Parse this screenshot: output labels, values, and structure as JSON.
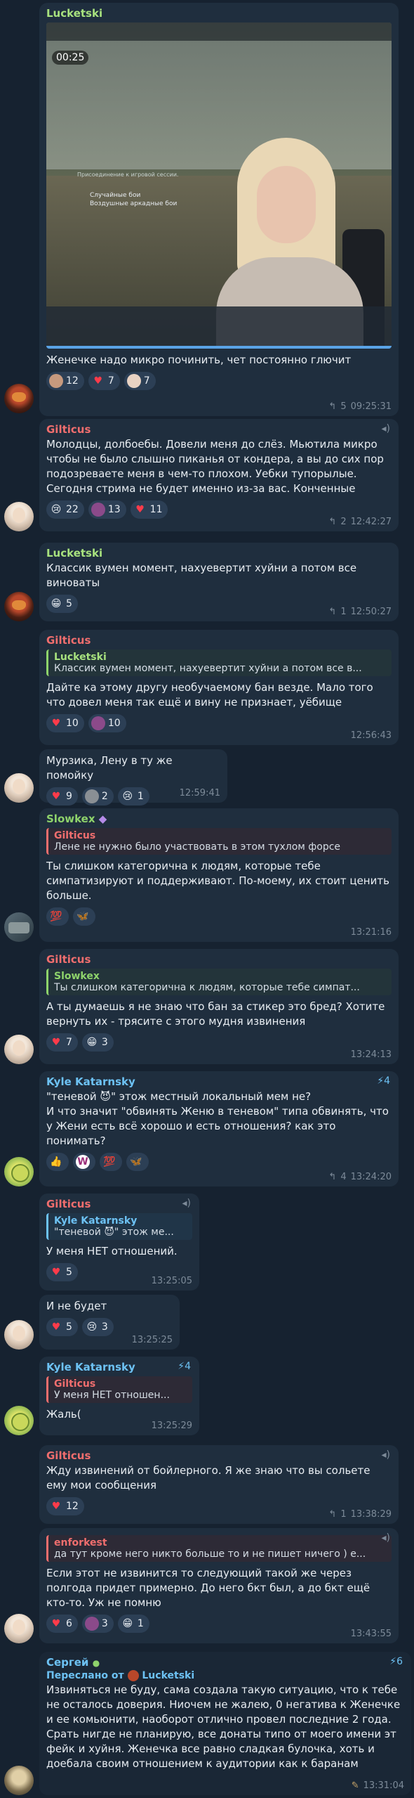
{
  "messages": {
    "m1": {
      "sender": "Lucketski",
      "video_duration": "00:25",
      "video_overlay_1": "Присоединение к игровой сессии.",
      "video_overlay_2": "Случайные бои",
      "video_overlay_3": "Воздушные аркадные бои",
      "text": "Женечке надо микро починить, чет постоянно глючит",
      "reactions": [
        {
          "icon": "face-avatar",
          "count": "12"
        },
        {
          "icon": "heart",
          "count": "7"
        },
        {
          "icon": "face-avatar",
          "count": "7"
        }
      ],
      "replies": "5",
      "time": "09:25:31"
    },
    "m2": {
      "sender": "Gilticus",
      "text": "Молодцы, долбоебы. Довели меня до слёз. Мьютила микро чтобы не было слышно пиканья от кондера, а вы до сих пор подозреваете меня в чем-то плохом. Уебки тупорылые. Сегодня стрима не будет именно из-за вас. Конченные",
      "reactions": [
        {
          "icon": "😢",
          "count": "22"
        },
        {
          "icon": "face-avatar",
          "count": "13"
        },
        {
          "icon": "heart",
          "count": "11"
        }
      ],
      "replies": "2",
      "time": "12:42:27"
    },
    "m3": {
      "sender": "Lucketski",
      "text": "Классик вумен момент, нахуевертит хуйни а потом все виноваты",
      "reactions": [
        {
          "icon": "😁",
          "count": "5"
        }
      ],
      "replies": "1",
      "time": "12:50:27"
    },
    "m4": {
      "sender": "Gilticus",
      "reply_name": "Lucketski",
      "reply_text": "Классик вумен момент, нахуевертит хуйни а потом все в...",
      "text": "Дайте ка этому другу необучаемому бан везде. Мало того что довел меня так ещё и вину не признает, уёбище",
      "reactions": [
        {
          "icon": "heart",
          "count": "10"
        },
        {
          "icon": "face-avatar",
          "count": "10"
        }
      ],
      "time": "12:56:43"
    },
    "m5": {
      "text": "Мурзика, Лену в ту же помойку",
      "reactions": [
        {
          "icon": "heart",
          "count": "9"
        },
        {
          "icon": "face-avatar",
          "count": "2"
        },
        {
          "icon": "😢",
          "count": "1"
        }
      ],
      "time": "12:59:41"
    },
    "m6": {
      "sender": "Slowkex",
      "reply_name": "Gilticus",
      "reply_text": "Лене не нужно было участвовать в этом тухлом форсе",
      "text": "Ты слишком категорична к людям, которые тебе симпатизируют и поддерживают. По-моему, их стоит ценить больше.",
      "reactions": [
        {
          "icon": "💯",
          "count": ""
        },
        {
          "icon": "🦋",
          "count": ""
        }
      ],
      "time": "13:21:16"
    },
    "m7": {
      "sender": "Gilticus",
      "reply_name": "Slowkex",
      "reply_text": "Ты слишком категорична к людям, которые тебе симпат...",
      "text": "А ты думаешь я не знаю что бан за стикер это бред? Хотите вернуть их - трясите с этого мудня извинения",
      "reactions": [
        {
          "icon": "heart",
          "count": "7"
        },
        {
          "icon": "😁",
          "count": "3"
        }
      ],
      "time": "13:24:13"
    },
    "m8": {
      "sender": "Kyle Katarnsky",
      "badge": "4",
      "text": "\"теневой 😈\" этож местный локальный мем не?\nИ что значит \"обвинять Женю в теневом\" типа обвинять, что у Жени есть всё хорошо и есть отношения? как это понимать?",
      "reactions": [
        {
          "icon": "👍",
          "count": ""
        },
        {
          "icon": "W",
          "count": ""
        },
        {
          "icon": "💯",
          "count": ""
        },
        {
          "icon": "🦋",
          "count": ""
        }
      ],
      "replies": "4",
      "time": "13:24:20"
    },
    "m9": {
      "sender": "Gilticus",
      "reply_name": "Kyle Katarnsky",
      "reply_text": "\"теневой 😈\" этож ме...",
      "text": "У меня НЕТ отношений.",
      "reactions": [
        {
          "icon": "heart",
          "count": "5"
        }
      ],
      "time": "13:25:05"
    },
    "m10": {
      "text": "И не будет",
      "reactions": [
        {
          "icon": "heart",
          "count": "5"
        },
        {
          "icon": "😢",
          "count": "3"
        }
      ],
      "time": "13:25:25"
    },
    "m11": {
      "sender": "Kyle Katarnsky",
      "badge": "4",
      "reply_name": "Gilticus",
      "reply_text": "У меня НЕТ отношен...",
      "text": "Жаль(",
      "time": "13:25:29"
    },
    "m12": {
      "sender": "Gilticus",
      "text": "Жду извинений от бойлерного. Я же знаю что вы сольете ему мои сообщения",
      "reactions": [
        {
          "icon": "heart",
          "count": "12"
        }
      ],
      "replies": "1",
      "time": "13:38:29"
    },
    "m13": {
      "reply_name": "enforkest",
      "reply_text": "да тут кроме него никто больше то и не пишет ничего ) е...",
      "text": "Если этот не извинится то следующий такой же через полгода придет примерно. До него бкт был, а до бкт ещё кто-то. Уж не помню",
      "reactions": [
        {
          "icon": "heart",
          "count": "6"
        },
        {
          "icon": "face-avatar",
          "count": "3"
        },
        {
          "icon": "😁",
          "count": "1"
        }
      ],
      "time": "13:43:55"
    },
    "m14": {
      "sender": "Сергей",
      "badge": "6",
      "forwarded_label": "Переслано от",
      "forwarded_from": "Lucketski",
      "text": "Извиняться не буду, сама создала такую ситуацию, что к тебе не осталось доверия. Ниочем не жалею, 0 негатива к Женечке и ее комьюнити, наоборот отлично провел последние 2 года. Срать нигде не планирую, все донаты типо от моего имени эт фейк и хуйня. Женечка все равно сладкая булочка, хоть и доебала своим отношением к аудитории как к баранам",
      "time": "13:31:04"
    }
  }
}
